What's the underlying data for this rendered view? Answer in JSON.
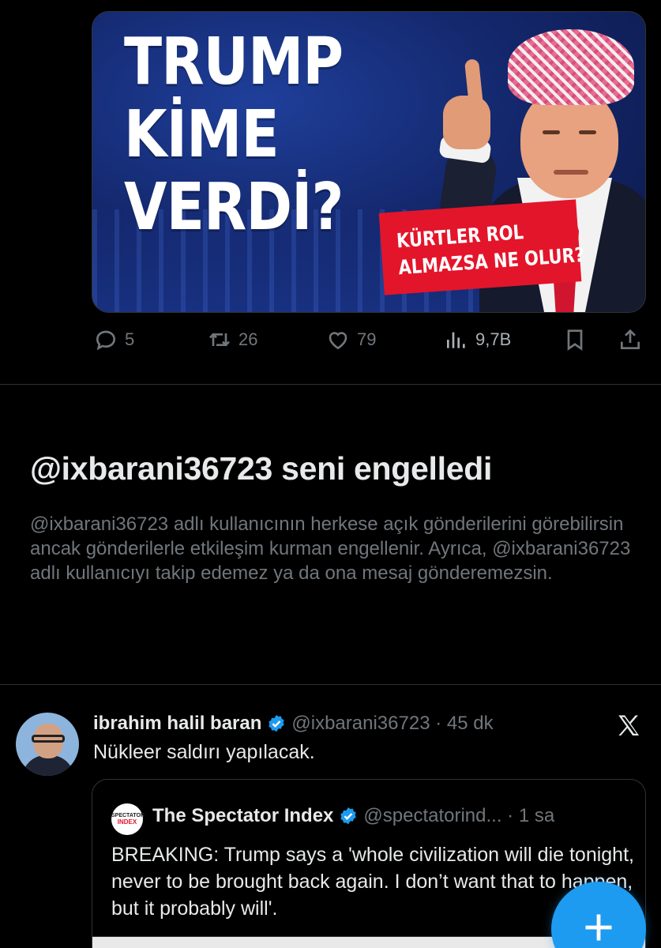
{
  "media_card": {
    "headline": [
      "TRUMP",
      "KİME",
      "VERDİ?"
    ],
    "tag": [
      "KÜRTLER ROL",
      "ALMAZSA NE OLUR?"
    ]
  },
  "actions": {
    "replies": "5",
    "reposts": "26",
    "likes": "79",
    "views": "9,7B"
  },
  "blocked": {
    "title": "@ixbarani36723 seni engelledi",
    "body": "@ixbarani36723 adlı kullanıcının herkese açık gönderilerini görebilirsin ancak gönderilerle etkileşim kurman engellenir. Ayrıca, @ixbarani36723 adlı kullanıcıyı takip edemez ya da ona mesaj gönderemezsin."
  },
  "tweet": {
    "name": "ibrahim halil baran",
    "handle_time": "@ixbarani36723 · 45 dk",
    "text": "Nükleer saldırı yapılacak."
  },
  "quote": {
    "avatar_top": "SPECTATOR",
    "avatar_bottom": "INDEX",
    "name": "The Spectator Index",
    "handle_time": "@spectatorind... · 1 sa",
    "text": "BREAKING: Trump says a 'whole civilization will die tonight, never to be brought back again. I don’t want that to happen, but it probably will'."
  },
  "colors": {
    "background": "#000000",
    "text_primary": "#e7e9ea",
    "text_secondary": "#71767b",
    "accent": "#1d9bf0",
    "divider": "#2f3336"
  },
  "icons": [
    "reply-icon",
    "repost-icon",
    "like-icon",
    "views-icon",
    "bookmark-icon",
    "share-icon",
    "verified-badge-icon",
    "x-logo-icon",
    "plus-icon"
  ]
}
